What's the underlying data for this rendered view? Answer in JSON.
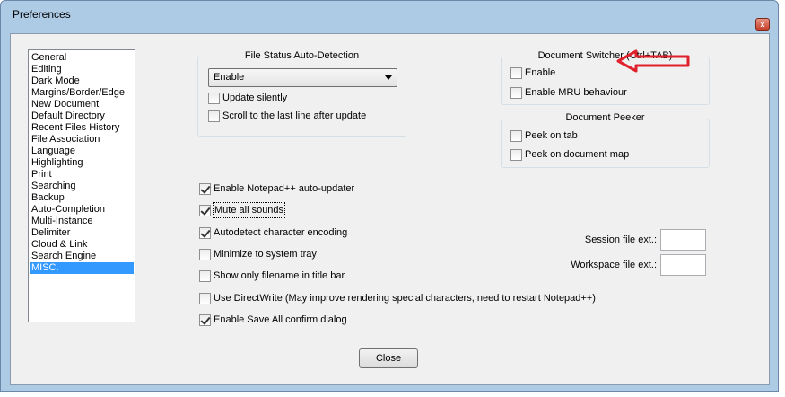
{
  "window": {
    "title": "Preferences",
    "close_glyph": "x"
  },
  "categories": [
    {
      "label": "General",
      "selected": false
    },
    {
      "label": "Editing",
      "selected": false
    },
    {
      "label": "Dark Mode",
      "selected": false
    },
    {
      "label": "Margins/Border/Edge",
      "selected": false
    },
    {
      "label": "New Document",
      "selected": false
    },
    {
      "label": "Default Directory",
      "selected": false
    },
    {
      "label": "Recent Files History",
      "selected": false
    },
    {
      "label": "File Association",
      "selected": false
    },
    {
      "label": "Language",
      "selected": false
    },
    {
      "label": "Highlighting",
      "selected": false
    },
    {
      "label": "Print",
      "selected": false
    },
    {
      "label": "Searching",
      "selected": false
    },
    {
      "label": "Backup",
      "selected": false
    },
    {
      "label": "Auto-Completion",
      "selected": false
    },
    {
      "label": "Multi-Instance",
      "selected": false
    },
    {
      "label": "Delimiter",
      "selected": false
    },
    {
      "label": "Cloud & Link",
      "selected": false
    },
    {
      "label": "Search Engine",
      "selected": false
    },
    {
      "label": "MISC.",
      "selected": true
    }
  ],
  "file_status": {
    "title": "File Status Auto-Detection",
    "selected_option": "Enable",
    "update_silently": {
      "label": "Update silently",
      "checked": false
    },
    "scroll_last_line": {
      "label": "Scroll to the last line after update",
      "checked": false
    }
  },
  "doc_switcher": {
    "title": "Document Switcher (Ctrl+TAB)",
    "enable": {
      "label": "Enable",
      "checked": false
    },
    "mru": {
      "label": "Enable MRU behaviour",
      "checked": false
    }
  },
  "doc_peeker": {
    "title": "Document Peeker",
    "peek_tab": {
      "label": "Peek on tab",
      "checked": false
    },
    "peek_map": {
      "label": "Peek on document map",
      "checked": false
    }
  },
  "options": {
    "auto_updater": {
      "label": "Enable Notepad++ auto-updater",
      "checked": true
    },
    "mute_sounds": {
      "label": "Mute all sounds",
      "checked": true
    },
    "autodetect_encoding": {
      "label": "Autodetect character encoding",
      "checked": true
    },
    "minimize_tray": {
      "label": "Minimize to system tray",
      "checked": false
    },
    "filename_title": {
      "label": "Show only filename in title bar",
      "checked": false
    },
    "directwrite": {
      "label": "Use DirectWrite (May improve rendering special characters, need to restart Notepad++)",
      "checked": false
    },
    "save_all_confirm": {
      "label": "Enable Save All confirm dialog",
      "checked": true
    }
  },
  "session": {
    "session_ext_label": "Session file ext.:",
    "session_ext_value": "",
    "workspace_ext_label": "Workspace file ext.:",
    "workspace_ext_value": ""
  },
  "close_button": "Close",
  "annotation_color": "#e0202a"
}
